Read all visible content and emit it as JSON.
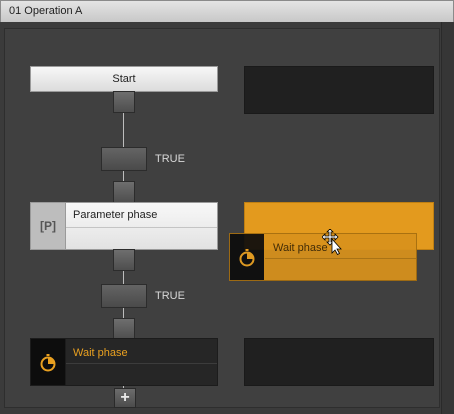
{
  "window": {
    "title": "01 Operation A"
  },
  "sequence": {
    "start_label": "Start",
    "transition_1_label": "TRUE",
    "transition_2_label": "TRUE",
    "parameter_step": {
      "icon_text": "[P]",
      "label": "Parameter phase"
    },
    "wait_step": {
      "label": "Wait phase"
    },
    "dragged_step": {
      "label": "Wait phase"
    },
    "add_button_label": "+"
  },
  "colors": {
    "accent": "#e39a1e",
    "dark_slot": "#202020",
    "step_light": "#f0f0f0"
  },
  "icons": {
    "parameter": "parameter-icon",
    "wait": "clock-icon",
    "cursor": "move-cursor-icon"
  }
}
